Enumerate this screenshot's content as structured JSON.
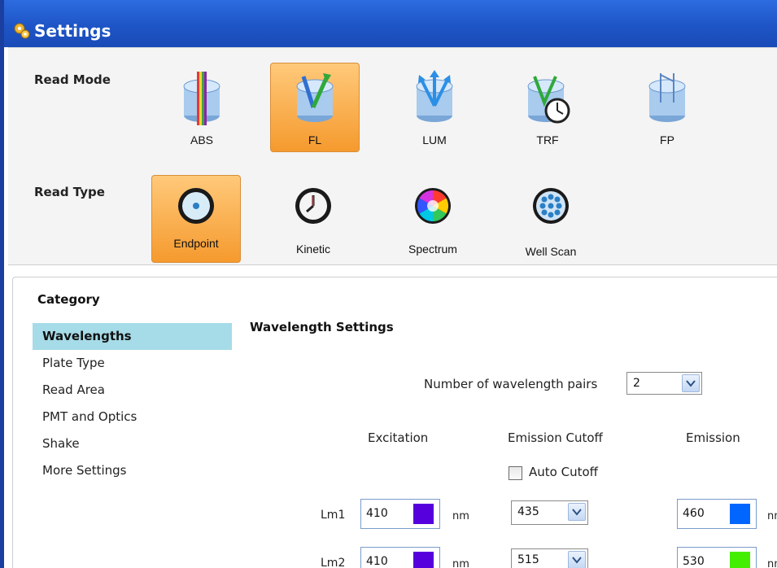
{
  "window": {
    "title": "Settings"
  },
  "read_mode": {
    "label": "Read Mode",
    "options": [
      {
        "label": "ABS"
      },
      {
        "label": "FL",
        "selected": true
      },
      {
        "label": "LUM"
      },
      {
        "label": "TRF"
      },
      {
        "label": "FP"
      }
    ]
  },
  "read_type": {
    "label": "Read Type",
    "options": [
      {
        "label": "Endpoint",
        "selected": true
      },
      {
        "label": "Kinetic"
      },
      {
        "label": "Spectrum"
      },
      {
        "label": "Well Scan"
      }
    ]
  },
  "category": {
    "title": "Category",
    "items": [
      "Wavelengths",
      "Plate Type",
      "Read Area",
      "PMT and Optics",
      "Shake",
      "More Settings"
    ],
    "selected": "Wavelengths"
  },
  "wavelength_settings": {
    "title": "Wavelength Settings",
    "pairs_label": "Number of wavelength pairs",
    "pairs_value": "2",
    "col_excitation": "Excitation",
    "col_emission_cutoff": "Emission Cutoff",
    "col_emission": "Emission",
    "auto_cutoff_label": "Auto Cutoff",
    "auto_cutoff_checked": false,
    "unit": "nm",
    "rows": [
      {
        "label": "Lm1",
        "excitation": "410",
        "excitation_color": "#5500dd",
        "cutoff": "435",
        "emission": "460",
        "emission_color": "#0066ff"
      },
      {
        "label": "Lm2",
        "excitation": "410",
        "excitation_color": "#5500dd",
        "cutoff": "515",
        "emission": "530",
        "emission_color": "#44ee00"
      }
    ]
  },
  "colors": {
    "titlebar": "#1e55c6",
    "selected_tile": "#f59a2e",
    "selected_category": "#a6dbe8"
  }
}
